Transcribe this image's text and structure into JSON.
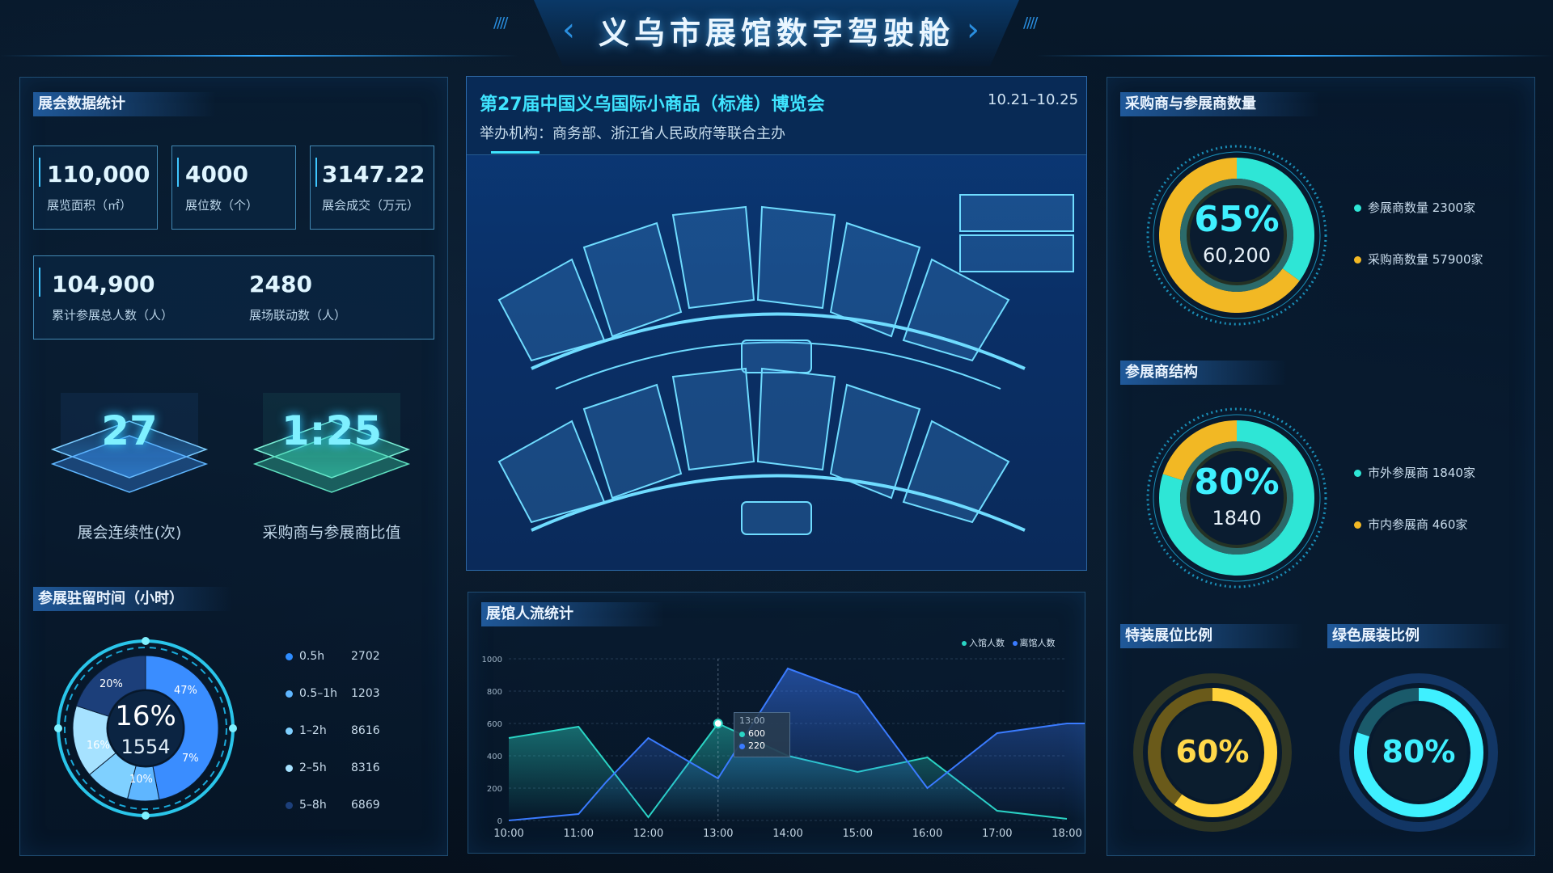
{
  "header": {
    "title": "义乌市展馆数字驾驶舱"
  },
  "stats": {
    "section_title": "展会数据统计",
    "area": {
      "value": "110,000",
      "label": "展览面积（㎡）"
    },
    "booths": {
      "value": "4000",
      "label": "展位数（个）"
    },
    "deals": {
      "value": "3147.22",
      "label": "展会成交（万元）"
    },
    "visitors": {
      "value": "104,900",
      "label": "累计参展总人数（人）"
    },
    "linkage": {
      "value": "2480",
      "label": "展场联动数（人）"
    },
    "continuity": {
      "value": "27",
      "label": "展会连续性(次)"
    },
    "ratio": {
      "value": "1:25",
      "label": "采购商与参展商比值"
    }
  },
  "stay": {
    "section_title": "参展驻留时间（小时）",
    "center_pct": "16%",
    "center_val": "1554",
    "slice_labels": [
      "47%",
      "20%",
      "16%",
      "10%",
      "7%"
    ],
    "slices": [
      47,
      7,
      10,
      16,
      20
    ],
    "slice_colors": [
      "#3a8dff",
      "#5fb6ff",
      "#7fd0ff",
      "#a6e2ff",
      "#1c3f7a"
    ],
    "legend": [
      {
        "label": "0.5h",
        "value": "2702",
        "color": "#2e8cff"
      },
      {
        "label": "0.5–1h",
        "value": "1203",
        "color": "#5fb6ff"
      },
      {
        "label": "1–2h",
        "value": "8616",
        "color": "#7fd0ff"
      },
      {
        "label": "2–5h",
        "value": "8316",
        "color": "#a6e2ff"
      },
      {
        "label": "5–8h",
        "value": "6869",
        "color": "#1c3f7a"
      }
    ]
  },
  "expo": {
    "name": "第27届中国义乌国际小商品（标准）博览会",
    "dates": "10.21–10.25",
    "organizer": "举办机构：商务部、浙江省人民政府等联合主办"
  },
  "flow": {
    "section_title": "展馆人流统计",
    "legend_in": "入馆人数",
    "legend_out": "离馆人数",
    "tooltip": {
      "time": "13:00",
      "in": "600",
      "out": "220"
    }
  },
  "chart_data": {
    "type": "line",
    "categories": [
      "10:00",
      "11:00",
      "12:00",
      "13:00",
      "14:00",
      "15:00",
      "16:00",
      "17:00",
      "18:00"
    ],
    "ylim": [
      0,
      1000
    ],
    "yticks": [
      0,
      200,
      400,
      600,
      800,
      1000
    ],
    "series": [
      {
        "name": "入馆人数",
        "color": "#2ad4c4",
        "x": [
          0,
          1,
          2,
          3,
          4,
          5,
          6,
          7,
          8
        ],
        "values": [
          510,
          580,
          20,
          600,
          400,
          300,
          390,
          60,
          10
        ]
      },
      {
        "name": "离馆人数",
        "color": "#3a7bff",
        "x": [
          0,
          1,
          1.4,
          2,
          3,
          4,
          5,
          6,
          7,
          8,
          8.3
        ],
        "values": [
          0,
          40,
          240,
          510,
          260,
          940,
          780,
          200,
          540,
          600,
          600
        ]
      }
    ]
  },
  "buyers": {
    "section_title": "采购商与参展商数量",
    "pct": "65%",
    "total": "60,200",
    "parts": [
      35,
      65
    ],
    "legend": [
      {
        "label": "参展商数量 2300家",
        "color": "#2ee6d6"
      },
      {
        "label": "采购商数量 57900家",
        "color": "#f2b824"
      }
    ]
  },
  "structure": {
    "section_title": "参展商结构",
    "pct": "80%",
    "total": "1840",
    "parts": [
      80,
      20
    ],
    "legend": [
      {
        "label": "市外参展商 1840家",
        "color": "#2ee6d6"
      },
      {
        "label": "市内参展商 460家",
        "color": "#f2b824"
      }
    ]
  },
  "special": {
    "section_title": "特装展位比例",
    "pct": "60%",
    "value": 60
  },
  "green": {
    "section_title": "绿色展装比例",
    "pct": "80%",
    "value": 80
  }
}
